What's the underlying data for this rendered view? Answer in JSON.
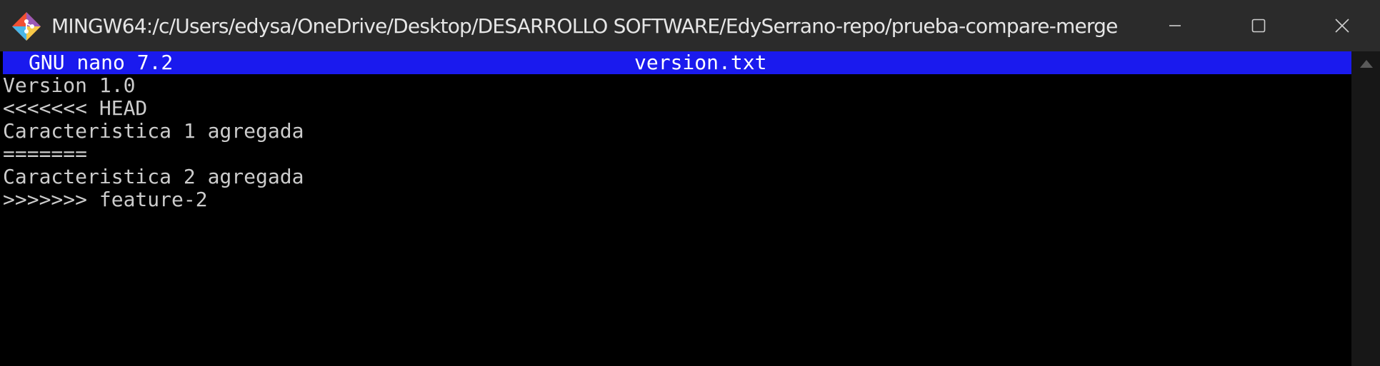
{
  "window": {
    "title": "MINGW64:/c/Users/edysa/OneDrive/Desktop/DESARROLLO SOFTWARE/EdySerrano-repo/prueba-compare-merge",
    "app_icon": "git-bash-icon",
    "controls": {
      "minimize": "minimize-icon",
      "maximize": "maximize-icon",
      "close": "close-icon"
    }
  },
  "nano": {
    "version_label": "GNU nano 7.2",
    "filename": "version.txt",
    "header_color": "#1a1aee"
  },
  "file_lines": [
    "Version 1.0",
    "<<<<<<< HEAD",
    "Caracteristica 1 agregada",
    "=======",
    "Caracteristica 2 agregada",
    ">>>>>>> feature-2"
  ]
}
